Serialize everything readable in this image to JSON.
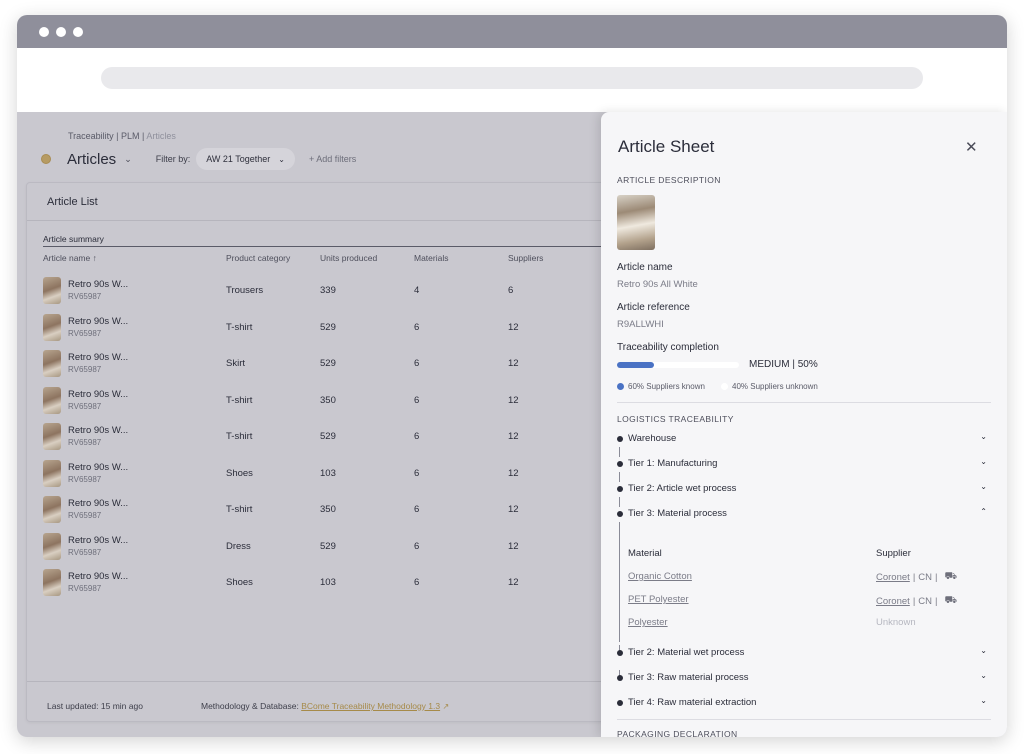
{
  "browser": {},
  "app": {
    "breadcrumb": {
      "part1": "Traceability | PLM | ",
      "part2": "Articles"
    },
    "title": "Articles",
    "filter_label": "Filter by:",
    "filter_value": "AW 21 Together",
    "add_filters": "+ Add filters"
  },
  "list": {
    "title": "Article List",
    "summary_label": "Article summary",
    "columns": [
      "Article name ↑",
      "Product category",
      "Units produced",
      "Materials",
      "Suppliers"
    ],
    "rows": [
      {
        "name": "Retro 90s W...",
        "ref": "RV65987",
        "category": "Trousers",
        "units": "339",
        "materials": "4",
        "suppliers": "6"
      },
      {
        "name": "Retro 90s W...",
        "ref": "RV65987",
        "category": "T-shirt",
        "units": "529",
        "materials": "6",
        "suppliers": "12"
      },
      {
        "name": "Retro 90s W...",
        "ref": "RV65987",
        "category": "Skirt",
        "units": "529",
        "materials": "6",
        "suppliers": "12"
      },
      {
        "name": "Retro 90s W...",
        "ref": "RV65987",
        "category": "T-shirt",
        "units": "350",
        "materials": "6",
        "suppliers": "12"
      },
      {
        "name": "Retro 90s W...",
        "ref": "RV65987",
        "category": "T-shirt",
        "units": "529",
        "materials": "6",
        "suppliers": "12"
      },
      {
        "name": "Retro 90s W...",
        "ref": "RV65987",
        "category": "Shoes",
        "units": "103",
        "materials": "6",
        "suppliers": "12"
      },
      {
        "name": "Retro 90s W...",
        "ref": "RV65987",
        "category": "T-shirt",
        "units": "350",
        "materials": "6",
        "suppliers": "12"
      },
      {
        "name": "Retro 90s W...",
        "ref": "RV65987",
        "category": "Dress",
        "units": "529",
        "materials": "6",
        "suppliers": "12"
      },
      {
        "name": "Retro 90s W...",
        "ref": "RV65987",
        "category": "Shoes",
        "units": "103",
        "materials": "6",
        "suppliers": "12"
      }
    ],
    "footer": {
      "updated_label": "Last updated:",
      "updated_value": "15 min ago",
      "method_label": "Methodology & Database:",
      "method_link": "BCome Traceability Methodology 1.3"
    }
  },
  "panel": {
    "title": "Article Sheet",
    "close_icon": "close-icon",
    "article_description_label": "ARTICLE DESCRIPTION",
    "article_name_label": "Article name",
    "article_name": "Retro 90s All White",
    "article_reference_label": "Article reference",
    "article_reference": "R9ALLWHI",
    "traceability_label": "Traceability completion",
    "traceability_fraction": 0.5,
    "traceability_text": "MEDIUM | 50%",
    "legend_known": "60% Suppliers known",
    "legend_unknown": "40% Suppliers unknown",
    "colors": {
      "known": "#4a72c4",
      "unknown": "#ffffff",
      "link_gold": "#a68a49"
    },
    "logistics_label": "LOGISTICS TRACEABILITY",
    "tiers_top": [
      "Warehouse",
      "Tier 1: Manufacturing",
      "Tier 2: Article wet process",
      "Tier 3: Material process"
    ],
    "material_header": "Material",
    "supplier_header": "Supplier",
    "materials": [
      {
        "material": "Organic Cotton",
        "supplier": "Coronet",
        "country": "CN",
        "icon": "truck-icon"
      },
      {
        "material": "PET Polyester",
        "supplier": "Coronet",
        "country": "CN",
        "icon": "truck-icon"
      },
      {
        "material": "Polyester",
        "supplier_unknown": "Unknown"
      }
    ],
    "tiers_bottom": [
      "Tier 2: Material wet process",
      "Tier 3: Raw material process",
      "Tier 4: Raw material extraction"
    ],
    "packaging_label": "PACKAGING DECLARATION"
  }
}
